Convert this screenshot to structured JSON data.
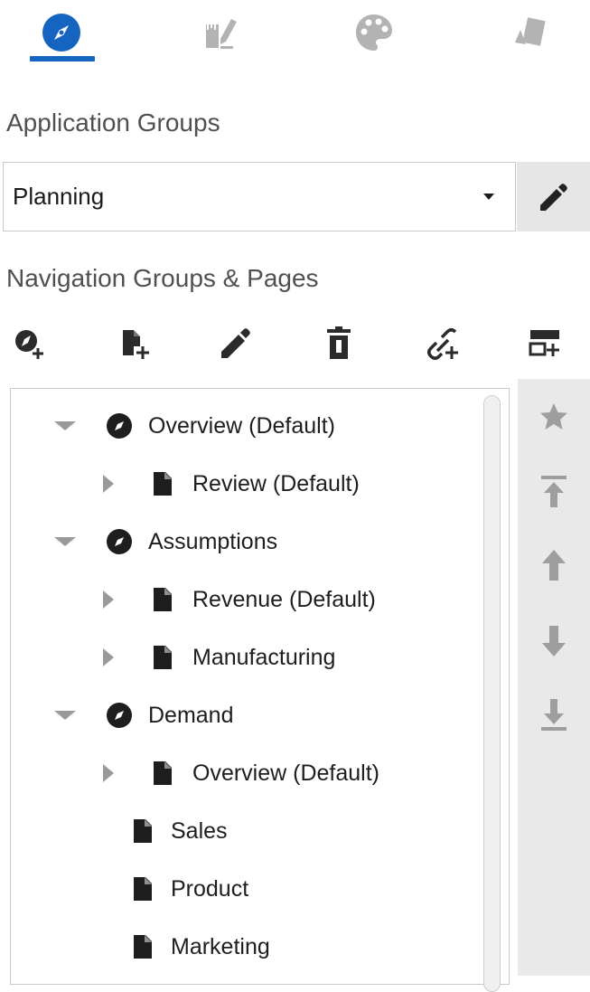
{
  "tabs": [
    {
      "name": "navigation",
      "icon": "compass-icon",
      "active": true
    },
    {
      "name": "design",
      "icon": "pencil-ruler-icon",
      "active": false
    },
    {
      "name": "theme",
      "icon": "palette-icon",
      "active": false
    },
    {
      "name": "cards",
      "icon": "cards-icon",
      "active": false
    }
  ],
  "application_groups": {
    "title": "Application Groups",
    "selected": "Planning"
  },
  "navigation": {
    "title": "Navigation Groups & Pages",
    "toolbar": [
      "add-group-icon",
      "add-page-icon",
      "edit-icon",
      "delete-icon",
      "add-link-icon",
      "add-section-icon"
    ]
  },
  "tree": [
    {
      "label": "Overview (Default)",
      "type": "group",
      "expanded": true
    },
    {
      "label": "Review (Default)",
      "type": "page",
      "collapsed": true
    },
    {
      "label": "Assumptions",
      "type": "group",
      "expanded": true
    },
    {
      "label": "Revenue (Default)",
      "type": "page",
      "collapsed": true
    },
    {
      "label": "Manufacturing",
      "type": "page",
      "collapsed": true
    },
    {
      "label": "Demand",
      "type": "group",
      "expanded": true
    },
    {
      "label": "Overview (Default)",
      "type": "page",
      "collapsed": true
    },
    {
      "label": "Sales",
      "type": "page"
    },
    {
      "label": "Product",
      "type": "page"
    },
    {
      "label": "Marketing",
      "type": "page"
    }
  ],
  "rail": [
    "star-icon",
    "move-top-icon",
    "move-up-icon",
    "move-down-icon",
    "move-bottom-icon"
  ],
  "colors": {
    "accent": "#1565c0",
    "icon": "#2b2b2b",
    "icon_muted": "#b3b3b3",
    "rail_bg": "#e9e9e9"
  }
}
